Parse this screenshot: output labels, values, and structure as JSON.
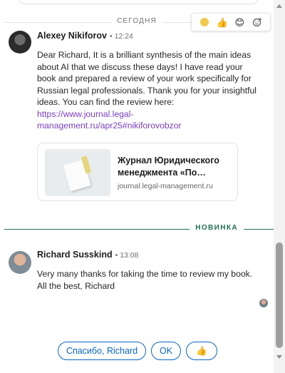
{
  "separators": {
    "today": "СЕГОДНЯ",
    "new": "НОВИНКА"
  },
  "reactions": [
    "like",
    "thumbs-up",
    "smile",
    "add-reaction"
  ],
  "messages": [
    {
      "sender": "Alexey Nikiforov",
      "time": "12:24",
      "text": "Dear Richard, It is a brilliant synthesis of the main ideas about AI that we discuss these days! I have read your book and prepared a review of your work specifically for Russian legal professionals. Thank you for your insightful ideas. You can find the review here: ",
      "link": "https://www.journal.legal-management.ru/apr25#nikiforovobzor",
      "preview": {
        "title": "Журнал Юридического менеджмента «По…",
        "domain": "journal.legal-management.ru"
      }
    },
    {
      "sender": "Richard Susskind",
      "time": "13:08",
      "text": "Very many thanks for taking the time to review my book. All the best, Richard"
    }
  ],
  "quick_replies": {
    "reply1": "Спасибо, Richard",
    "reply2": "OK",
    "reply3": "👍"
  },
  "colors": {
    "accent": "#0a66c2",
    "new_separator": "#1f6e52",
    "link": "#7b3fc1"
  }
}
